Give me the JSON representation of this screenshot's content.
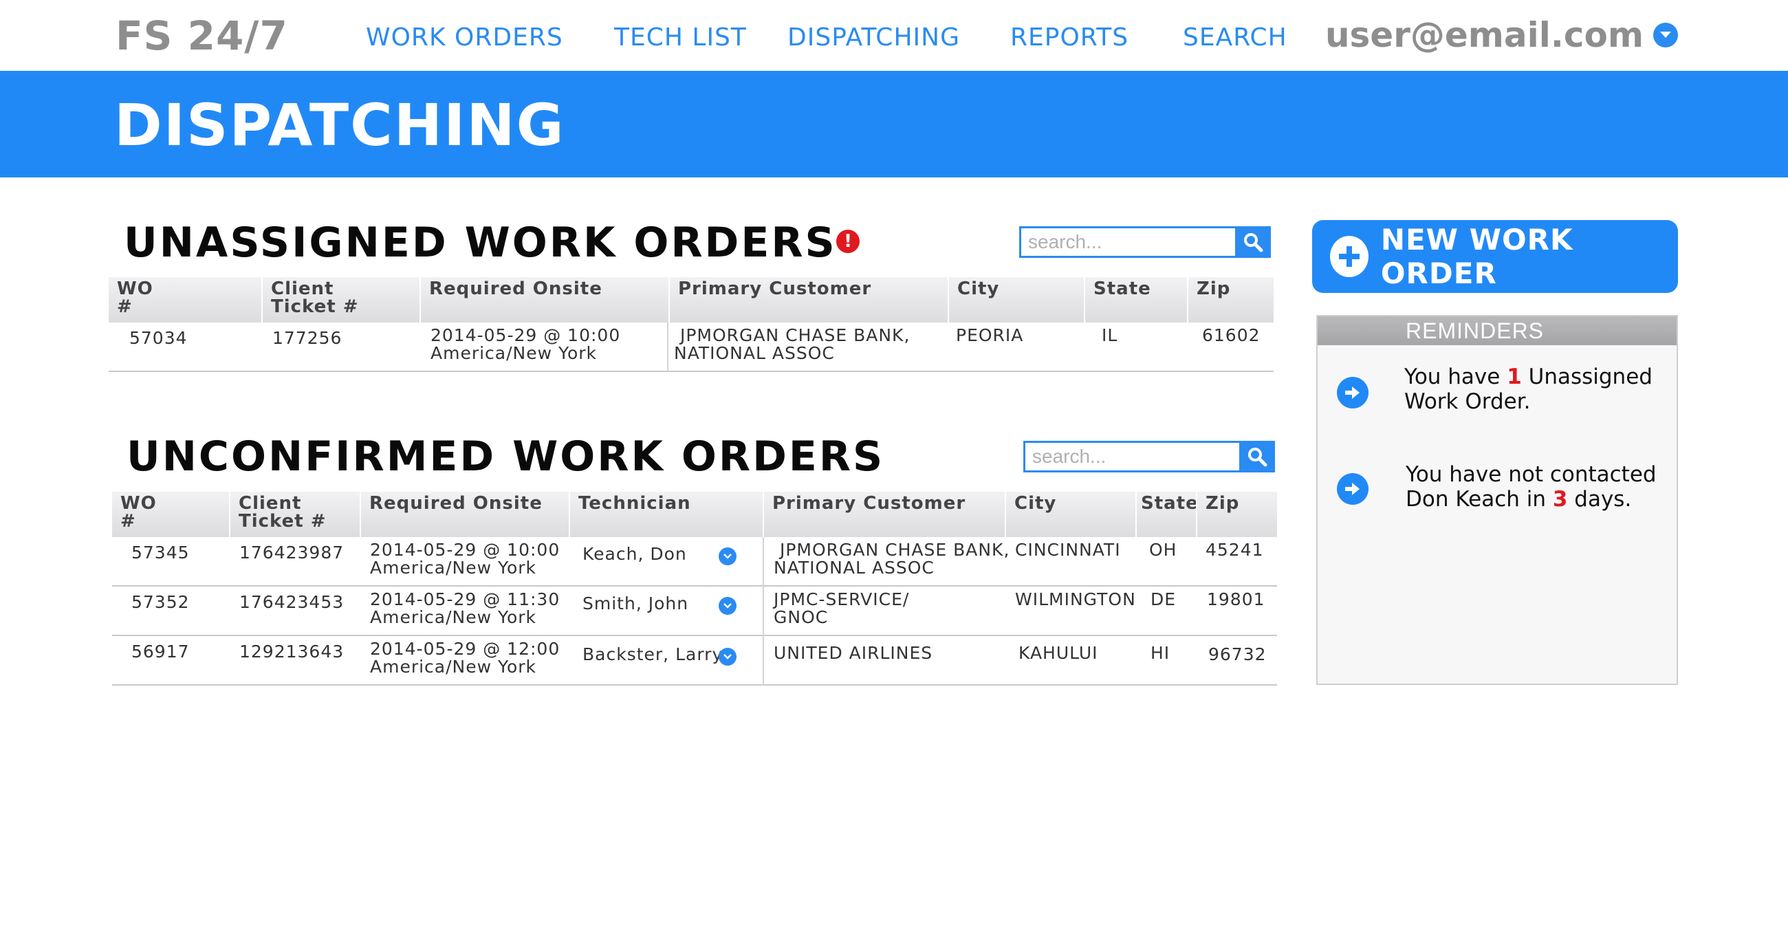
{
  "nav": {
    "brand": "FS 24/7",
    "links": [
      "WORK ORDERS",
      "TECH LIST",
      "DISPATCHING",
      "REPORTS",
      "SEARCH"
    ],
    "user_email": "user@email.com"
  },
  "banner": {
    "title": "DISPATCHING"
  },
  "unassigned": {
    "title": "UNASSIGNED WORK ORDERS",
    "alert_icon": "!",
    "search_placeholder": "search...",
    "columns": [
      "WO\n#",
      "Client\nTicket #",
      "Required Onsite",
      "Primary Customer",
      "City",
      "State",
      "Zip"
    ],
    "rows": [
      {
        "wo": "57034",
        "ticket": "177256",
        "onsite_line1": "2014-05-29 @ 10:00",
        "onsite_line2": "America/New York",
        "customer_line1": " JPMORGAN CHASE BANK,",
        "customer_line2": "NATIONAL ASSOC",
        "city": "PEORIA",
        "state": "IL",
        "zip": "61602"
      }
    ]
  },
  "unconfirmed": {
    "title": "UNCONFIRMED WORK ORDERS",
    "search_placeholder": "search...",
    "columns": [
      "WO\n#",
      "Client\nTicket #",
      "Required Onsite",
      "Technician",
      "Primary Customer",
      "City",
      "State",
      "Zip"
    ],
    "rows": [
      {
        "wo": "57345",
        "ticket": "176423987",
        "onsite_line1": "2014-05-29 @ 10:00",
        "onsite_line2": "America/New York",
        "tech": "Keach, Don",
        "customer_line1": " JPMORGAN CHASE BANK,",
        "customer_line2": "NATIONAL ASSOC",
        "city": "CINCINNATI",
        "state": "OH",
        "zip": "45241"
      },
      {
        "wo": "57352",
        "ticket": "176423453",
        "onsite_line1": "2014-05-29 @ 11:30",
        "onsite_line2": "America/New York",
        "tech": "Smith, John",
        "customer_line1": "JPMC-SERVICE/",
        "customer_line2": "GNOC",
        "city": "WILMINGTON",
        "state": "DE",
        "zip": "19801"
      },
      {
        "wo": "56917",
        "ticket": "129213643",
        "onsite_line1": "2014-05-29 @ 12:00",
        "onsite_line2": "America/New York",
        "tech": "Backster, Larry",
        "customer_line1": "UNITED AIRLINES",
        "customer_line2": "",
        "city": "KAHULUI",
        "state": "HI",
        "zip": "96732"
      }
    ]
  },
  "new_work_order": {
    "label": "NEW WORK ORDER"
  },
  "reminders": {
    "title": "REMINDERS",
    "items": [
      {
        "pre": "You have ",
        "highlight": "1",
        "post": " Unassigned Work Order."
      },
      {
        "pre": "You have not contacted Don Keach in ",
        "highlight": "3",
        "post": " days."
      }
    ]
  },
  "colors": {
    "accent": "#2189f6",
    "alert": "#e0191f",
    "brand_gray": "#8e8e8e"
  },
  "icons": {
    "search": "magnifier-icon",
    "dropdown": "chevron-down-icon",
    "add": "plus-icon",
    "reminder": "arrow-right-icon",
    "alert": "exclamation-icon"
  }
}
